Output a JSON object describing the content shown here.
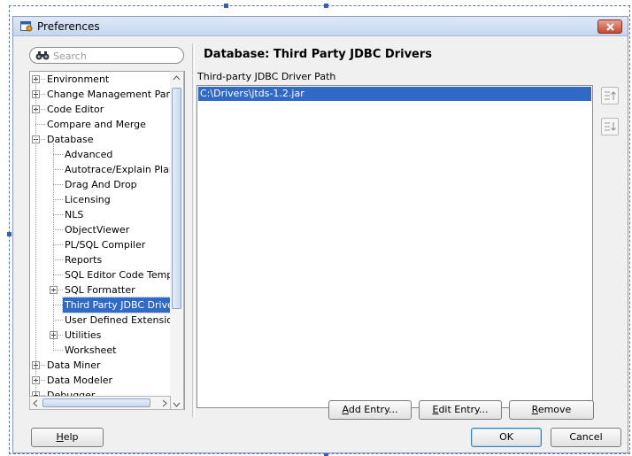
{
  "window": {
    "title": "Preferences"
  },
  "search": {
    "placeholder": "Search"
  },
  "tree": {
    "items": [
      {
        "label": "Environment",
        "expander": "plus"
      },
      {
        "label": "Change Management Paran",
        "expander": "plus"
      },
      {
        "label": "Code Editor",
        "expander": "plus"
      },
      {
        "label": "Compare and Merge",
        "expander": "none"
      },
      {
        "label": "Database",
        "expander": "minus"
      },
      {
        "label": "Advanced",
        "expander": "none"
      },
      {
        "label": "Autotrace/Explain Plan",
        "expander": "none"
      },
      {
        "label": "Drag And Drop",
        "expander": "none"
      },
      {
        "label": "Licensing",
        "expander": "none"
      },
      {
        "label": "NLS",
        "expander": "none"
      },
      {
        "label": "ObjectViewer",
        "expander": "none"
      },
      {
        "label": "PL/SQL Compiler",
        "expander": "none"
      },
      {
        "label": "Reports",
        "expander": "none"
      },
      {
        "label": "SQL Editor Code Templa",
        "expander": "none"
      },
      {
        "label": "SQL Formatter",
        "expander": "plus"
      },
      {
        "label": "Third Party JDBC Driver",
        "expander": "none",
        "selected": true
      },
      {
        "label": "User Defined Extension",
        "expander": "none"
      },
      {
        "label": "Utilities",
        "expander": "plus"
      },
      {
        "label": "Worksheet",
        "expander": "none"
      },
      {
        "label": "Data Miner",
        "expander": "plus"
      },
      {
        "label": "Data Modeler",
        "expander": "plus"
      },
      {
        "label": "Debugger",
        "expander": "plus"
      }
    ]
  },
  "panel": {
    "title": "Database: Third Party JDBC Drivers",
    "field_label": "Third-party JDBC Driver Path",
    "paths": [
      "C:\\Drivers\\jtds-1.2.jar"
    ]
  },
  "buttons": {
    "add_entry": {
      "mnemonic": "A",
      "rest": "dd Entry..."
    },
    "edit_entry": {
      "mnemonic": "E",
      "rest": "dit Entry..."
    },
    "remove": {
      "mnemonic": "R",
      "rest": "emove"
    },
    "help": {
      "mnemonic": "H",
      "rest": "elp"
    },
    "ok": "OK",
    "cancel": "Cancel"
  },
  "icons": {
    "app": "preferences-app-icon",
    "close": "close-icon",
    "search": "binoculars-search-icon",
    "move_up": "move-up-icon",
    "move_down": "move-down-icon"
  }
}
